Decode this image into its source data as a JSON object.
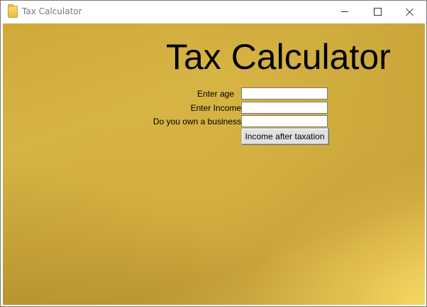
{
  "window": {
    "title": "Tax Calculator",
    "icon": "folder-icon",
    "controls": {
      "minimize": "minimize-icon",
      "maximize": "maximize-icon",
      "close": "close-icon"
    }
  },
  "main": {
    "heading": "Tax Calculator",
    "background_color": "#d2af41",
    "form": {
      "age_label": "Enter age",
      "age_value": "",
      "income_label": "Enter Income",
      "income_value": "",
      "business_label": "Do you own a business",
      "business_value": "",
      "submit_label": "Income after taxation"
    }
  }
}
